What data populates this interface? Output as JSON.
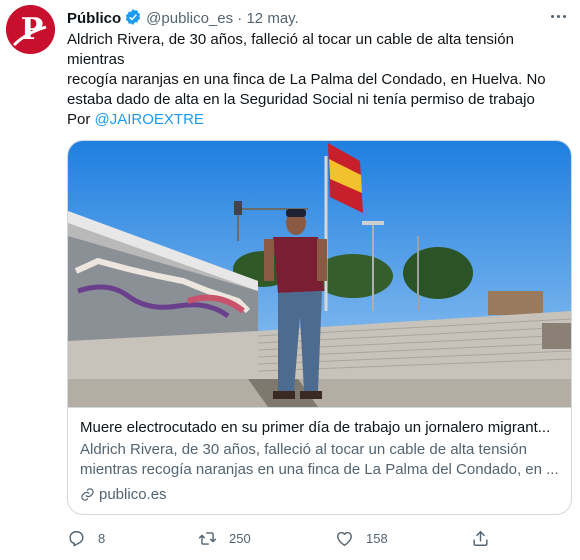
{
  "tweet": {
    "author_name": "Público",
    "handle": "@publico_es",
    "separator": "·",
    "date": "12 may.",
    "text_lines": [
      "Aldrich Rivera, de 30 años, falleció al tocar un cable de alta tensión mientras",
      "recogía naranjas en una finca de La Palma del Condado, en Huelva. No",
      "estaba dado de alta en la Seguridad Social ni tenía permiso de trabajo"
    ],
    "byline_prefix": "Por ",
    "byline_mention": "@JAIROEXTRE"
  },
  "avatar_letter": "P",
  "card": {
    "title": "Muere electrocutado en su primer día de trabajo un jornalero migrant...",
    "description_lines": [
      "Aldrich Rivera, de 30 años, falleció al tocar un cable de alta tensión",
      "mientras recogía naranjas en una finca de La Palma del Condado, en ..."
    ],
    "domain": "publico.es"
  },
  "actions": {
    "reply_count": "8",
    "retweet_count": "250",
    "like_count": "158"
  },
  "icons": [
    "verified-badge-icon",
    "more-options-icon",
    "link-icon",
    "reply-icon",
    "retweet-icon",
    "like-icon",
    "share-icon"
  ],
  "colors": {
    "brand_red": "#c8102e",
    "link_blue": "#1d9bf0",
    "secondary_text": "#536471",
    "border": "#cfd9de"
  }
}
